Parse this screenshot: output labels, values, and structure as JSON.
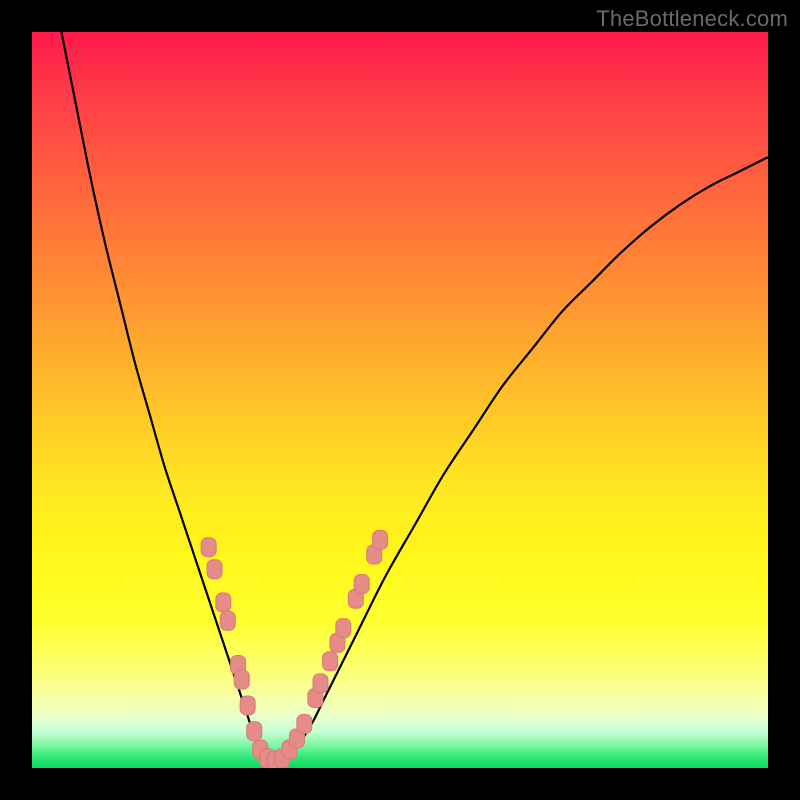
{
  "watermark": "TheBottleneck.com",
  "colors": {
    "frame": "#000000",
    "curve": "#000000",
    "marker_fill": "#e58b88",
    "marker_stroke": "#d87a77",
    "gradient_top": "#ff1a4b",
    "gradient_bottom": "#10d860"
  },
  "chart_data": {
    "type": "line",
    "title": "",
    "xlabel": "",
    "ylabel": "",
    "xlim": [
      0,
      100
    ],
    "ylim": [
      0,
      100
    ],
    "grid": false,
    "legend": false,
    "note": "No axis ticks or numeric labels are visible; x/y values are normalized 0–100 estimates read from pixel positions.",
    "series": [
      {
        "name": "bottleneck-curve",
        "x": [
          4,
          6,
          8,
          10,
          12,
          14,
          16,
          18,
          20,
          22,
          24,
          25,
          26,
          27,
          28,
          29,
          30,
          31,
          32,
          33,
          34,
          36,
          38,
          40,
          44,
          48,
          52,
          56,
          60,
          64,
          68,
          72,
          76,
          80,
          84,
          88,
          92,
          96,
          100
        ],
        "y": [
          100,
          90,
          80,
          71,
          63,
          55,
          48,
          41,
          35,
          29,
          23,
          20,
          17,
          14,
          11,
          8,
          5,
          3,
          1.5,
          1,
          1.2,
          3,
          6,
          10,
          18,
          26,
          33,
          40,
          46,
          52,
          57,
          62,
          66,
          70,
          73.5,
          76.5,
          79,
          81,
          83
        ]
      }
    ],
    "markers": [
      {
        "x": 24.0,
        "y": 30.0
      },
      {
        "x": 24.8,
        "y": 27.0
      },
      {
        "x": 26.0,
        "y": 22.5
      },
      {
        "x": 26.6,
        "y": 20.0
      },
      {
        "x": 28.0,
        "y": 14.0
      },
      {
        "x": 28.5,
        "y": 12.0
      },
      {
        "x": 29.3,
        "y": 8.5
      },
      {
        "x": 30.2,
        "y": 5.0
      },
      {
        "x": 31.0,
        "y": 2.5
      },
      {
        "x": 32.0,
        "y": 1.3
      },
      {
        "x": 33.0,
        "y": 1.0
      },
      {
        "x": 34.0,
        "y": 1.3
      },
      {
        "x": 35.0,
        "y": 2.5
      },
      {
        "x": 36.0,
        "y": 4.0
      },
      {
        "x": 37.0,
        "y": 6.0
      },
      {
        "x": 38.5,
        "y": 9.5
      },
      {
        "x": 39.2,
        "y": 11.5
      },
      {
        "x": 40.5,
        "y": 14.5
      },
      {
        "x": 41.5,
        "y": 17.0
      },
      {
        "x": 42.3,
        "y": 19.0
      },
      {
        "x": 44.0,
        "y": 23.0
      },
      {
        "x": 44.8,
        "y": 25.0
      },
      {
        "x": 46.5,
        "y": 29.0
      },
      {
        "x": 47.3,
        "y": 31.0
      }
    ]
  }
}
